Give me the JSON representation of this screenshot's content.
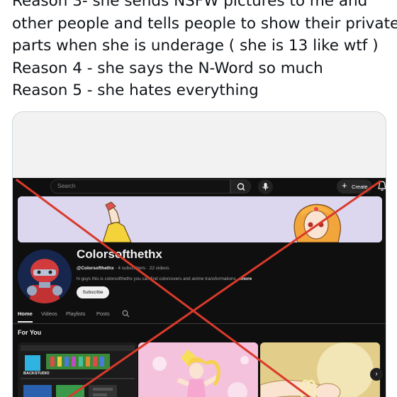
{
  "post": {
    "lines": [
      "Reason 3- she sends NSFW pictures to me and",
      "other people and tells people to show their private",
      "parts when she is underage ( she is 13 like wtf )",
      "Reason 4 - she says the N-Word so much",
      "Reason 5 - she hates everything"
    ]
  },
  "youtube": {
    "search": {
      "placeholder": "Search"
    },
    "create_label": "Create",
    "channel": {
      "name": "Colorsofthethx",
      "handle": "@Colorsofthethx",
      "meta": " · 4 subscribers · 22 videos",
      "description": "hi guys this is colorsofthethx you can find colorcovers and anime transformations",
      "more_label": "...more",
      "subscribe_label": "Subscribe"
    },
    "tabs": [
      {
        "label": "Home",
        "active": true
      },
      {
        "label": "Videos",
        "active": false
      },
      {
        "label": "Playlists",
        "active": false
      },
      {
        "label": "Posts",
        "active": false
      }
    ],
    "section_title": "For You",
    "thumbnail_1_text": "BACKSTUDIO"
  },
  "overlay": {
    "cross_color": "#d93a2b"
  },
  "icons": [
    "search-icon",
    "mic-icon",
    "plus-icon",
    "bell-icon",
    "tab-search-icon",
    "chevron-right-icon"
  ]
}
